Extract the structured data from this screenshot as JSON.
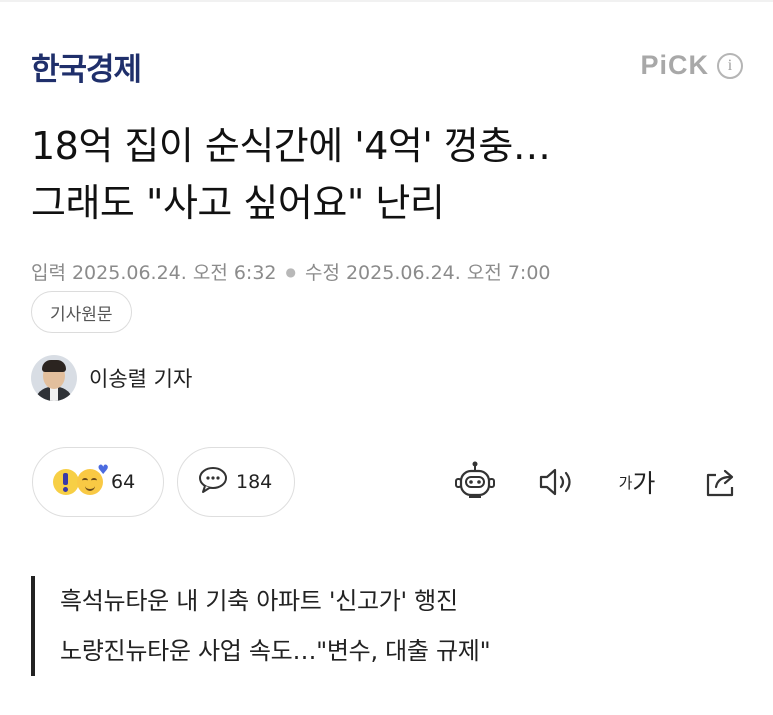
{
  "header": {
    "press_logo": "한국경제",
    "pick_label": "PiCK",
    "info_icon": "i"
  },
  "article": {
    "headline_lines": [
      "18억 집이 순식간에 '4억' 껑충…",
      "그래도 \"사고 싶어요\" 난리"
    ],
    "input_label": "입력",
    "input_date": "2025.06.24. 오전 6:32",
    "modified_label": "수정",
    "modified_date": "2025.06.24. 오전 7:00",
    "original_button": "기사원문",
    "reporter": "이송렬 기자"
  },
  "actions": {
    "reaction_count": "64",
    "comment_count": "184",
    "text_size_small": "가",
    "text_size_large": "가",
    "icons": [
      "surprise-emoji-icon",
      "love-emoji-icon",
      "comment-icon",
      "ai-summary-bot-icon",
      "speaker-icon",
      "text-size-icon",
      "share-icon"
    ]
  },
  "related_headlines": [
    "흑석뉴타운 내 기축 아파트 '신고가' 행진",
    "노량진뉴타운 사업 속도…\"변수, 대출 규제\""
  ]
}
